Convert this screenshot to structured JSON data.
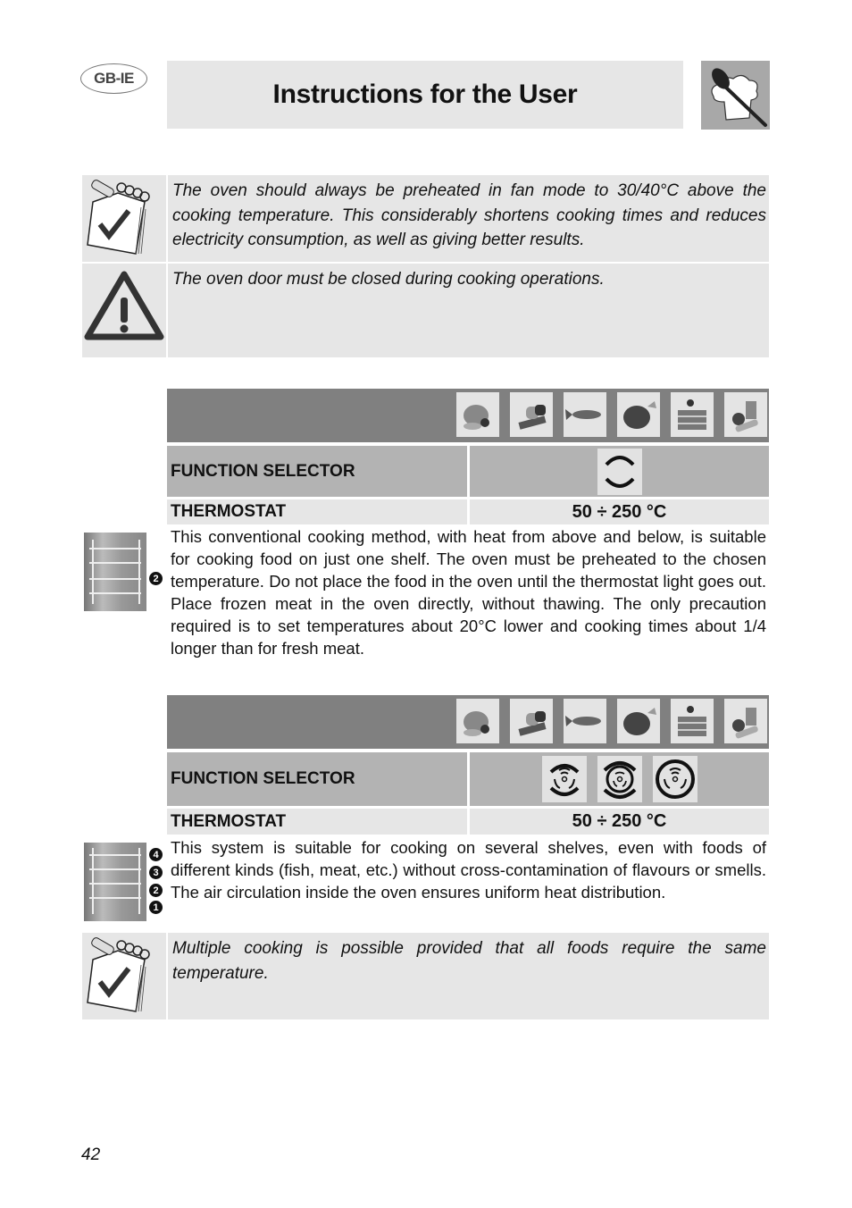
{
  "header": {
    "language_badge": "GB-IE",
    "title": "Instructions for the User",
    "logo_icon": "chef-hat-spoon-icon"
  },
  "notes": [
    {
      "icon": "notepad-check-icon",
      "text": "The oven should always be preheated in fan mode to 30/40°C above the cooking temperature. This considerably shortens cooking times and reduces electricity consumption, as well as giving better results."
    },
    {
      "icon": "warning-triangle-icon",
      "text": "The oven door must be closed during cooking operations."
    }
  ],
  "food_icons": [
    "meat-icon",
    "bread-icon",
    "fish-icon",
    "poultry-icon",
    "cake-icon",
    "vegetables-icon"
  ],
  "sections": [
    {
      "function_selector_label": "FUNCTION SELECTOR",
      "selector_icons": [
        "top-bottom-heat-icon"
      ],
      "thermostat_label": "THERMOSTAT",
      "thermostat_value": "50 ÷ 250 °C",
      "shelf_icon": "oven-shelf-icon",
      "shelf_positions": [
        "2"
      ],
      "description": "This conventional cooking method, with heat from above and below, is suitable for cooking food on just one shelf. The oven must be preheated to the chosen temperature. Do not place the food in the oven until the thermostat light goes out. Place frozen meat in the oven directly, without thawing. The only precaution required is to set temperatures about 20°C lower and cooking times about 1/4 longer than for fresh meat."
    },
    {
      "function_selector_label": "FUNCTION SELECTOR",
      "selector_icons": [
        "fan-assisted-icon",
        "fan-top-bottom-icon",
        "fan-circular-icon"
      ],
      "thermostat_label": "THERMOSTAT",
      "thermostat_value": "50 ÷ 250 °C",
      "shelf_icon": "oven-shelf-icon",
      "shelf_positions": [
        "4",
        "3",
        "2",
        "1"
      ],
      "description": "This system is suitable for cooking on several shelves, even with foods of different kinds (fish, meat, etc.) without cross-contamination of flavours or smells. The air circulation inside the oven ensures uniform heat distribution."
    }
  ],
  "bottom_note": {
    "icon": "notepad-check-icon",
    "text": "Multiple cooking is possible provided that all foods require the same temperature."
  },
  "page_number": "42"
}
